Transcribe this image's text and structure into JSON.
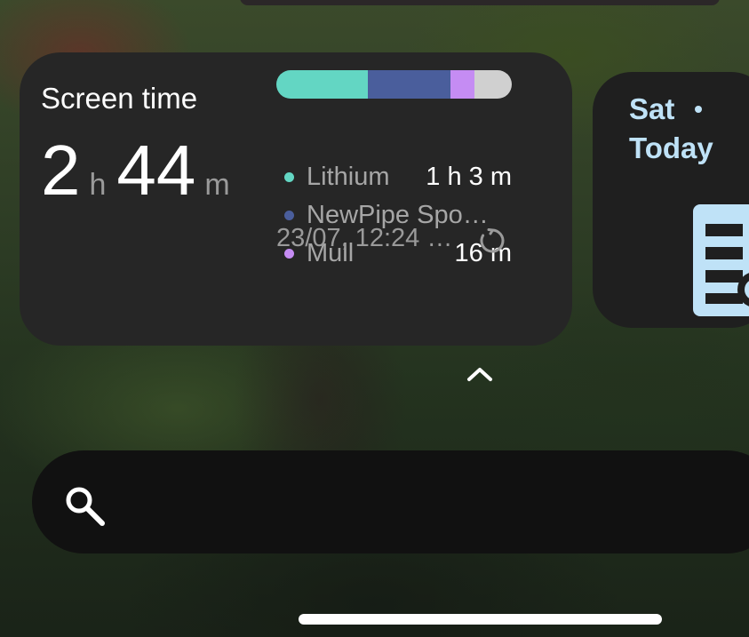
{
  "screen_time_widget": {
    "title": "Screen time",
    "total_hours": "2",
    "hours_unit": "h",
    "total_minutes": "44",
    "minutes_unit": "m",
    "usage_bar": [
      {
        "color": "#63d6c3",
        "fraction": 0.39
      },
      {
        "color": "#4a5e9c",
        "fraction": 0.35
      },
      {
        "color": "#c58cf3",
        "fraction": 0.1
      },
      {
        "color": "#d0d0d0",
        "fraction": 0.16
      }
    ],
    "apps": [
      {
        "name": "Lithium",
        "time": "1 h 3 m",
        "color": "#63d6c3"
      },
      {
        "name": "NewPipe Spo…",
        "time": "",
        "color": "#4a5e9c"
      },
      {
        "name": "Mull",
        "time": "16 m",
        "color": "#c58cf3"
      }
    ],
    "updated": "23/07, 12:24 …",
    "refresh_icon": "refresh-icon"
  },
  "calendar_widget": {
    "day": "Sat",
    "label": "Today",
    "accent": "#bfe2f7",
    "icon": "calendar-icon"
  },
  "search_bar": {
    "icon": "search-icon"
  },
  "expand_icon": "chevron-up-icon"
}
